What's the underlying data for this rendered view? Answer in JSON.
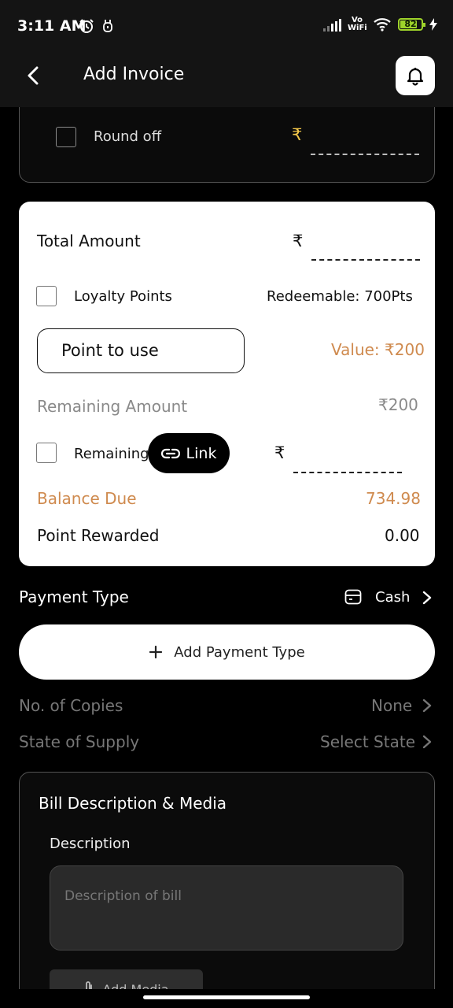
{
  "status_bar": {
    "time": "3:11 AM",
    "network_label": "Vo WiFi",
    "battery_level": "82",
    "battery_fraction": 0.82
  },
  "header": {
    "title": "Add Invoice"
  },
  "round_off": {
    "label": "Round off",
    "currency": "₹"
  },
  "amount_card": {
    "total_amount_label": "Total Amount",
    "total_currency": "₹",
    "loyalty_label": "Loyalty Points",
    "redeemable_text": "Redeemable: 700Pts",
    "points_placeholder": "Point to use",
    "points_value_text": "Value: ₹200",
    "remaining_amount_label": "Remaining Amount",
    "remaining_amount_value": "₹200",
    "remaining_label": "Remaining",
    "link_label": "Link",
    "remaining_currency": "₹",
    "balance_due_label": "Balance Due",
    "balance_due_value": "734.98",
    "point_rewarded_label": "Point Rewarded",
    "point_rewarded_value": "0.00"
  },
  "payment": {
    "label": "Payment Type",
    "selected_value": "Cash",
    "add_button_label": "Add Payment Type"
  },
  "copies": {
    "label": "No. of Copies",
    "value": "None"
  },
  "supply": {
    "label": "State of Supply",
    "value": "Select State"
  },
  "bill": {
    "title": "Bill Description & Media",
    "description_label": "Description",
    "description_placeholder": "Description of bill",
    "add_media_label": "Add Media"
  },
  "colors": {
    "accent_orange": "#cf8a4e",
    "rupee_yellow": "#f3c84a",
    "battery_green": "#9fd42a"
  }
}
